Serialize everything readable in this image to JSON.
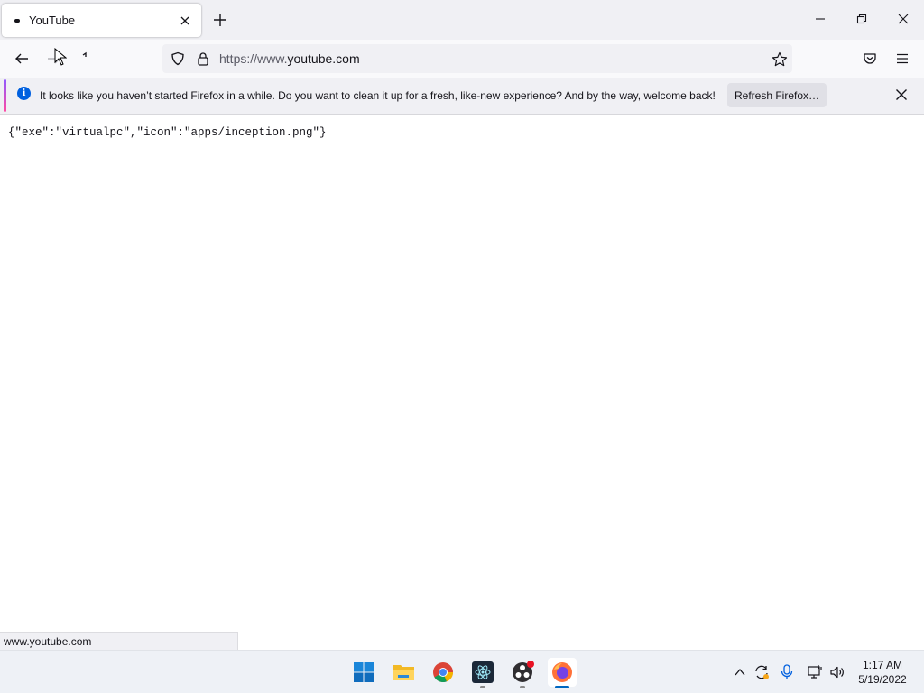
{
  "browser": {
    "tab": {
      "title": "YouTube"
    },
    "url": {
      "prefix": "https://www.",
      "host": "youtube.com"
    },
    "notification": {
      "message": "It looks like you haven’t started Firefox in a while. Do you want to clean it up for a fresh, like-new experience? And by the way, welcome back!",
      "button_label": "Refresh Firefox…"
    },
    "status_url": "www.youtube.com"
  },
  "page": {
    "content_text": "{\"exe\":\"virtualpc\",\"icon\":\"apps/inception.png\"}"
  },
  "taskbar": {
    "apps": [
      "windows-start",
      "file-explorer",
      "chrome",
      "electron-app",
      "obs-studio",
      "firefox"
    ],
    "clock": {
      "time": "1:17 AM",
      "date": "5/19/2022"
    }
  },
  "colors": {
    "accent": "#0060df",
    "notification_gradient_start": "#9059ff",
    "notification_gradient_end": "#ff4aa2",
    "taskbar_indicator": "#0067c0"
  }
}
